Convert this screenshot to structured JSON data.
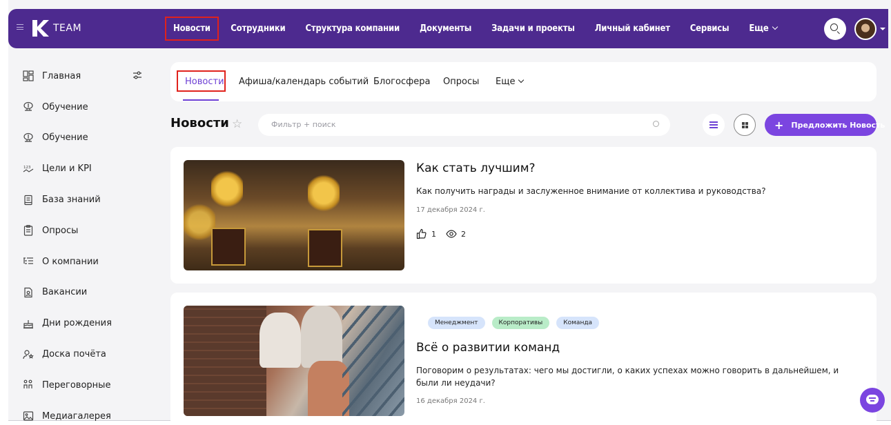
{
  "topbar": {
    "logo_text": "TEAM",
    "nav": [
      {
        "label": "Новости",
        "active": true
      },
      {
        "label": "Сотрудники"
      },
      {
        "label": "Структура компании"
      },
      {
        "label": "Документы"
      },
      {
        "label": "Задачи и проекты"
      },
      {
        "label": "Личный кабинет"
      },
      {
        "label": "Сервисы"
      },
      {
        "label": "Еще"
      }
    ]
  },
  "sidebar": {
    "items": [
      {
        "label": "Главная",
        "icon": "dashboard-icon"
      },
      {
        "label": "Обучение",
        "icon": "learning-icon"
      },
      {
        "label": "Обучение",
        "icon": "learning-icon"
      },
      {
        "label": "Цели и KPI",
        "icon": "kpi-icon"
      },
      {
        "label": "База знаний",
        "icon": "book-icon"
      },
      {
        "label": "Опросы",
        "icon": "survey-icon"
      },
      {
        "label": "О компании",
        "icon": "company-icon"
      },
      {
        "label": "Вакансии",
        "icon": "vacancies-icon"
      },
      {
        "label": "Дни рождения",
        "icon": "cake-icon"
      },
      {
        "label": "Доска почёта",
        "icon": "honor-icon"
      },
      {
        "label": "Переговорные",
        "icon": "meeting-room-icon"
      },
      {
        "label": "Медиагалерея",
        "icon": "gallery-icon"
      }
    ]
  },
  "subnav": {
    "tabs": [
      {
        "label": "Новости",
        "active": true
      },
      {
        "label": "Афиша/календарь событий"
      },
      {
        "label": "Блогосфера"
      },
      {
        "label": "Опросы"
      },
      {
        "label": "Еще"
      }
    ]
  },
  "page": {
    "title": "Новости",
    "filter_placeholder": "Фильтр + поиск",
    "suggest_button": "Предложить Новость"
  },
  "news": [
    {
      "title": "Как стать лучшим?",
      "description": "Как получить награды и заслуженное внимание от коллектива и руководства?",
      "date": "17 декабря 2024 г.",
      "likes": "1",
      "views": "2"
    },
    {
      "tags": [
        "Менеджмент",
        "Корпоративы",
        "Команда"
      ],
      "title": "Всё о развитии команд",
      "description": "Поговорим о результатах: чего мы достигли, о каких успехах можно говорить в дальнейшем, и были ли неудачи?",
      "date": "16 декабря 2024 г."
    }
  ],
  "colors": {
    "brand": "#4d2a8f",
    "accent": "#7b45e0",
    "highlight_border": "#e0221c",
    "tag_blue": "#d6e4fb",
    "tag_green": "#b9ecc8"
  }
}
